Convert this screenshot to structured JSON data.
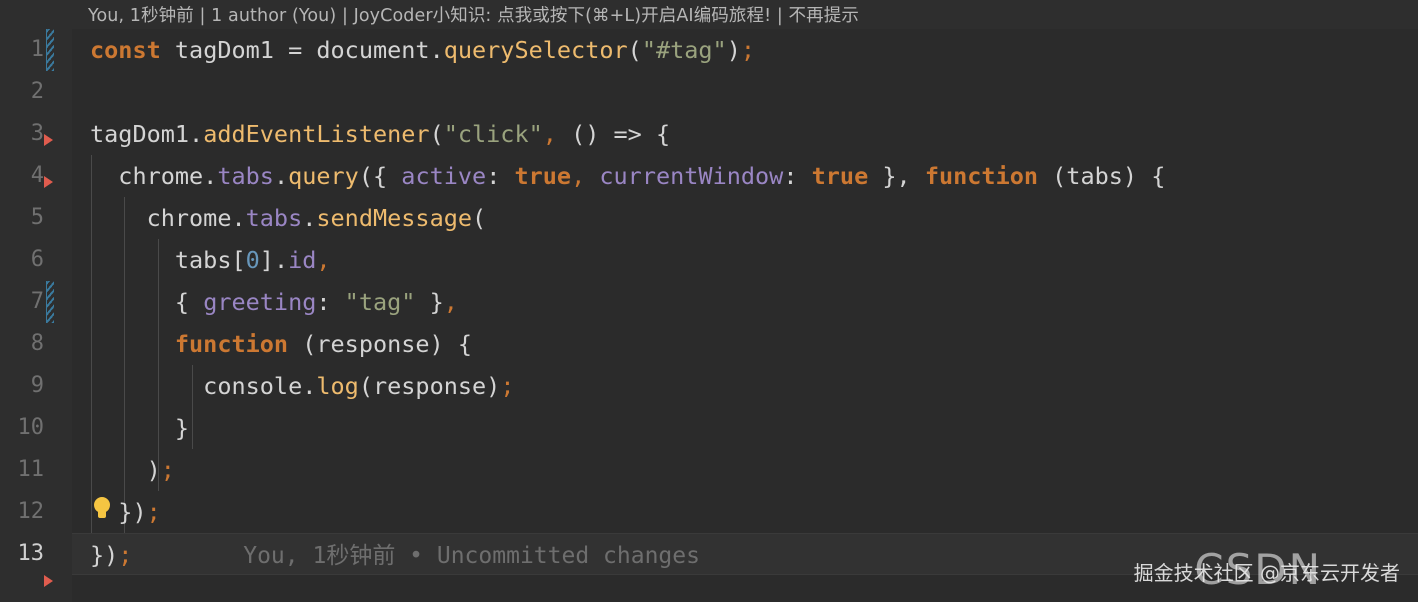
{
  "banner": {
    "text": "You, 1秒钟前 | 1 author (You) | JoyCoder小知识: 点我或按下(⌘+L)开启AI编码旅程! | 不再提示"
  },
  "gutter": {
    "line_numbers": [
      "1",
      "2",
      "3",
      "4",
      "5",
      "6",
      "7",
      "8",
      "9",
      "10",
      "11",
      "12",
      "13"
    ],
    "current_line": "13",
    "bulb_icon": "lightbulb-icon",
    "fold_markers": [
      "fold-arrow-icon",
      "fold-arrow-icon",
      "fold-arrow-icon"
    ],
    "change_bars": 2
  },
  "editor": {
    "language": "javascript",
    "background": "#2b2b2b",
    "current_line_background": "#323232",
    "lines": [
      {
        "n": "1",
        "tokens": [
          {
            "t": "const",
            "c": "t-kw"
          },
          {
            "t": " tagDom1 = document.",
            "c": "t-plain"
          },
          {
            "t": "querySelector",
            "c": "t-fn"
          },
          {
            "t": "(",
            "c": "t-plain"
          },
          {
            "t": "\"#tag\"",
            "c": "t-str"
          },
          {
            "t": ")",
            "c": "t-plain"
          },
          {
            "t": ";",
            "c": "t-punc"
          }
        ]
      },
      {
        "n": "2",
        "tokens": []
      },
      {
        "n": "3",
        "tokens": [
          {
            "t": "tagDom1.",
            "c": "t-plain"
          },
          {
            "t": "addEventListener",
            "c": "t-fn"
          },
          {
            "t": "(",
            "c": "t-plain"
          },
          {
            "t": "\"click\"",
            "c": "t-str"
          },
          {
            "t": ",",
            "c": "t-punc"
          },
          {
            "t": " () => {",
            "c": "t-plain"
          }
        ]
      },
      {
        "n": "4",
        "tokens": [
          {
            "t": "  chrome.",
            "c": "t-plain"
          },
          {
            "t": "tabs",
            "c": "t-prop"
          },
          {
            "t": ".",
            "c": "t-plain"
          },
          {
            "t": "query",
            "c": "t-fn"
          },
          {
            "t": "({ ",
            "c": "t-plain"
          },
          {
            "t": "active",
            "c": "t-prop"
          },
          {
            "t": ": ",
            "c": "t-plain"
          },
          {
            "t": "true",
            "c": "t-kw"
          },
          {
            "t": ",",
            "c": "t-punc"
          },
          {
            "t": " ",
            "c": "t-plain"
          },
          {
            "t": "currentWindow",
            "c": "t-prop"
          },
          {
            "t": ": ",
            "c": "t-plain"
          },
          {
            "t": "true",
            "c": "t-kw"
          },
          {
            "t": " },",
            "c": "t-plain"
          },
          {
            "t": " ",
            "c": "t-plain"
          },
          {
            "t": "function",
            "c": "t-kw"
          },
          {
            "t": " (tabs) {",
            "c": "t-plain"
          }
        ]
      },
      {
        "n": "5",
        "tokens": [
          {
            "t": "    chrome.",
            "c": "t-plain"
          },
          {
            "t": "tabs",
            "c": "t-prop"
          },
          {
            "t": ".",
            "c": "t-plain"
          },
          {
            "t": "sendMessage",
            "c": "t-fn"
          },
          {
            "t": "(",
            "c": "t-plain"
          }
        ]
      },
      {
        "n": "6",
        "tokens": [
          {
            "t": "      tabs[",
            "c": "t-plain"
          },
          {
            "t": "0",
            "c": "t-num"
          },
          {
            "t": "].",
            "c": "t-plain"
          },
          {
            "t": "id",
            "c": "t-prop"
          },
          {
            "t": ",",
            "c": "t-punc"
          }
        ]
      },
      {
        "n": "7",
        "tokens": [
          {
            "t": "      { ",
            "c": "t-plain"
          },
          {
            "t": "greeting",
            "c": "t-prop"
          },
          {
            "t": ": ",
            "c": "t-plain"
          },
          {
            "t": "\"tag\"",
            "c": "t-str"
          },
          {
            "t": " }",
            "c": "t-plain"
          },
          {
            "t": ",",
            "c": "t-punc"
          }
        ]
      },
      {
        "n": "8",
        "tokens": [
          {
            "t": "      ",
            "c": "t-plain"
          },
          {
            "t": "function",
            "c": "t-kw"
          },
          {
            "t": " (response) {",
            "c": "t-plain"
          }
        ]
      },
      {
        "n": "9",
        "tokens": [
          {
            "t": "        console.",
            "c": "t-plain"
          },
          {
            "t": "log",
            "c": "t-fn"
          },
          {
            "t": "(response)",
            "c": "t-plain"
          },
          {
            "t": ";",
            "c": "t-punc"
          }
        ]
      },
      {
        "n": "10",
        "tokens": [
          {
            "t": "      }",
            "c": "t-plain"
          }
        ]
      },
      {
        "n": "11",
        "tokens": [
          {
            "t": "    )",
            "c": "t-plain"
          },
          {
            "t": ";",
            "c": "t-punc"
          }
        ]
      },
      {
        "n": "12",
        "tokens": [
          {
            "t": "  })",
            "c": "t-plain"
          },
          {
            "t": ";",
            "c": "t-punc"
          }
        ]
      },
      {
        "n": "13",
        "tokens": [
          {
            "t": "})",
            "c": "t-plain"
          },
          {
            "t": ";",
            "c": "t-punc"
          }
        ]
      }
    ]
  },
  "inline_blame": {
    "text": "You, 1秒钟前 • Uncommitted changes"
  },
  "watermarks": {
    "juejin": "掘金技术社区 @京东云开发者",
    "csdn": "CSDN"
  }
}
